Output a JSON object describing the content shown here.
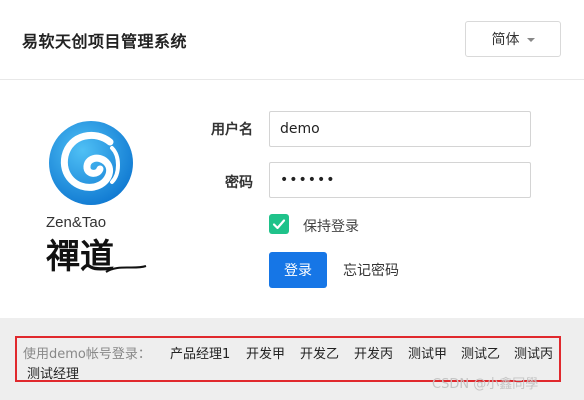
{
  "header": {
    "title": "易软天创项目管理系统",
    "language_label": "简体"
  },
  "logo": {
    "en_text": "Zen&Tao",
    "cn_text": "禪道"
  },
  "form": {
    "username_label": "用户名",
    "username_value": "demo",
    "password_label": "密码",
    "password_value": "••••••",
    "remember_label": "保持登录",
    "remember_checked": true,
    "login_button": "登录",
    "forgot_link": "忘记密码"
  },
  "demo": {
    "prompt": "使用demo帐号登录：",
    "users": [
      "产品经理1",
      "开发甲",
      "开发乙",
      "开发丙",
      "测试甲",
      "测试乙",
      "测试丙",
      "测试经理"
    ]
  },
  "watermark": "CSDN @小鑫同學",
  "colors": {
    "primary": "#1676e6",
    "checkbox": "#1fc28a",
    "highlight_border": "#e0282d",
    "logo_blue": "#1a8fe0"
  }
}
